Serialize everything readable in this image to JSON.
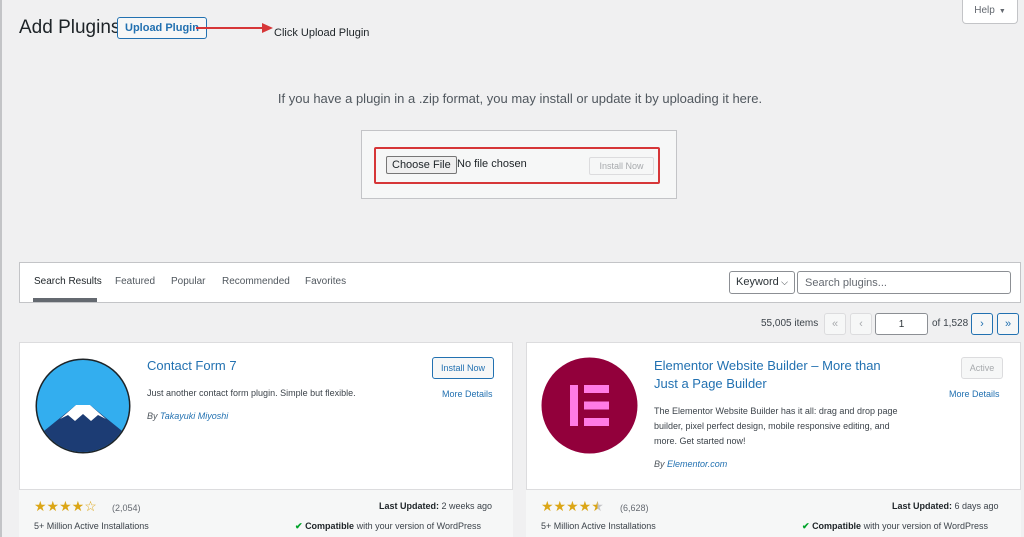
{
  "header": {
    "title": "Add Plugins",
    "upload_button": "Upload Plugin",
    "annotation": "Click Upload Plugin",
    "help": "Help"
  },
  "upload": {
    "description": "If you have a plugin in a .zip format, you may install or update it by uploading it here.",
    "choose_file": "Choose File",
    "no_file": "No file chosen",
    "install_now": "Install Now"
  },
  "tabs": [
    "Search Results",
    "Featured",
    "Popular",
    "Recommended",
    "Favorites"
  ],
  "search": {
    "type": "Keyword",
    "placeholder": "Search plugins..."
  },
  "pagination": {
    "items": "55,005 items",
    "first": "«",
    "prev": "‹",
    "current": "1",
    "of_pages": "of 1,528",
    "next": "›",
    "last": "»"
  },
  "plugins": [
    {
      "name": "Contact Form 7",
      "description": "Just another contact form plugin. Simple but flexible.",
      "author_prefix": "By",
      "author": "Takayuki Miyoshi",
      "action": "Install Now",
      "more_details": "More Details",
      "rating": 4,
      "ratings_count": "(2,054)",
      "last_updated_label": "Last Updated:",
      "last_updated": "2 weeks ago",
      "installs": "5+ Million Active Installations",
      "compat_bold": "Compatible",
      "compat_rest": "with your version of WordPress"
    },
    {
      "name": "Elementor Website Builder – More than Just a Page Builder",
      "description": "The Elementor Website Builder has it all: drag and drop page builder, pixel perfect design, mobile responsive editing, and more. Get started now!",
      "author_prefix": "By",
      "author": "Elementor.com",
      "action": "Active",
      "more_details": "More Details",
      "rating": 4.5,
      "ratings_count": "(6,628)",
      "last_updated_label": "Last Updated:",
      "last_updated": "6 days ago",
      "installs": "5+ Million Active Installations",
      "compat_bold": "Compatible",
      "compat_rest": "with your version of WordPress"
    }
  ],
  "colors": {
    "accent": "#2271b1",
    "annotation": "#d63638",
    "elementor": "#92003b",
    "contactform_sky": "#33aeef",
    "stars": "#dba617"
  },
  "icons": {
    "contact_form": "mount-fuji-logo",
    "elementor": "elementor-e-logo",
    "check": "check-icon",
    "arrow": "red-annotation-arrow"
  }
}
